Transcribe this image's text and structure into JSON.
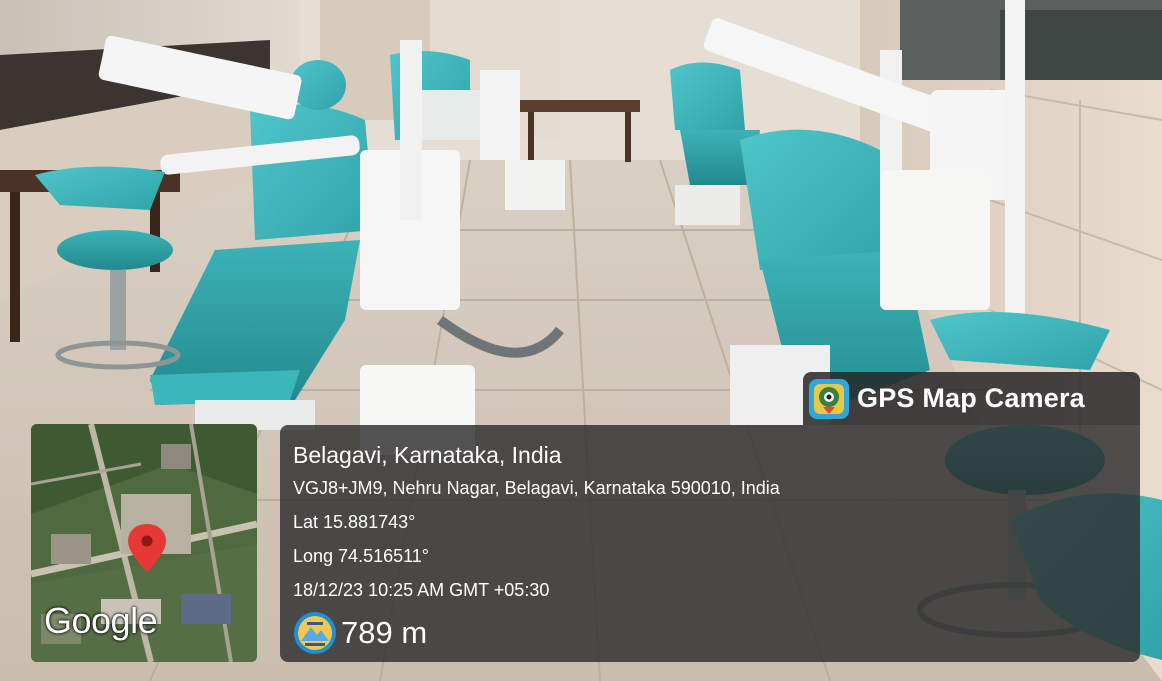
{
  "badge": {
    "label": "GPS Map Camera",
    "icon": "gps-map-camera-app-icon"
  },
  "location": {
    "city_line": "Belagavi, Karnataka, India",
    "address": "VGJ8+JM9, Nehru Nagar, Belagavi, Karnataka 590010, India",
    "lat": "Lat 15.881743°",
    "long": "Long 74.516511°",
    "datetime": "18/12/23 10:25 AM GMT +05:30",
    "altitude": "789 m"
  },
  "map": {
    "attribution": "Google",
    "pin_icon": "location-pin-icon"
  },
  "colors": {
    "chair_teal": "#3fb9bd",
    "overlay": "#2d2d2d",
    "pin_red": "#e53935"
  }
}
